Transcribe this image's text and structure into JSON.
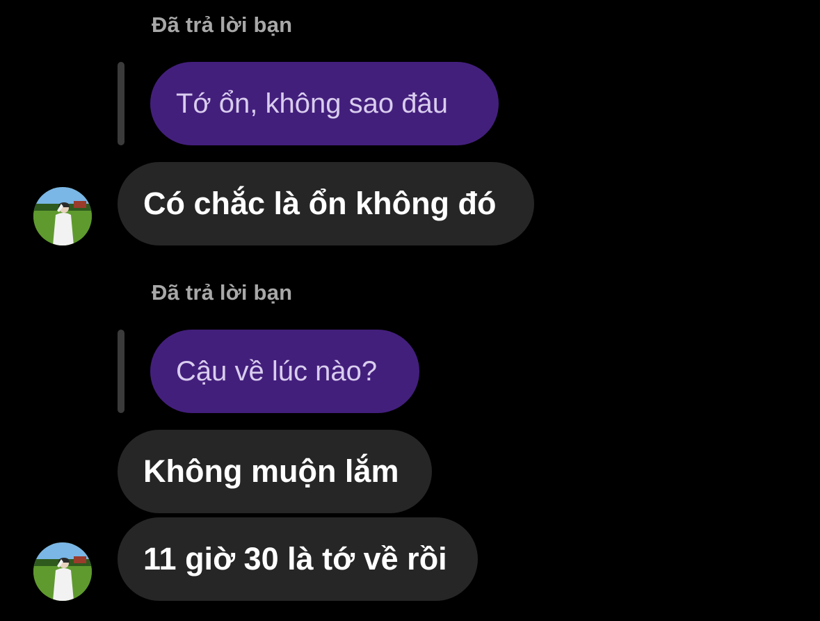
{
  "thread": {
    "groups": [
      {
        "reply_label": "Đã trả lời bạn",
        "quoted_text": "Tớ ổn, không sao đâu",
        "messages": [
          "Có chắc là ổn không đó"
        ]
      },
      {
        "reply_label": "Đã trả lời bạn",
        "quoted_text": "Cậu về lúc nào?",
        "messages": [
          "Không muộn lắm",
          "11 giờ 30 là tớ về rồi"
        ]
      }
    ]
  },
  "colors": {
    "background": "#000000",
    "incoming_bubble": "#262626",
    "quoted_bubble": "#431f7c",
    "quoted_text": "#d9cdee",
    "reply_label": "#a8a8a8"
  },
  "icons": {
    "avatar": "profile-photo"
  }
}
